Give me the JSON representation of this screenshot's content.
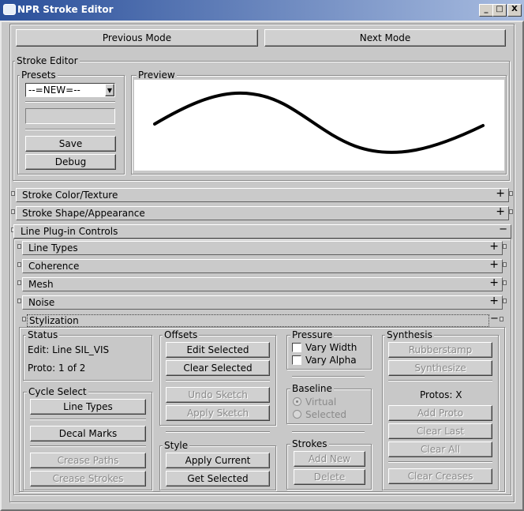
{
  "window": {
    "title": "NPR Stroke Editor",
    "minimize": "_",
    "maximize": "□",
    "close": "X"
  },
  "nav": {
    "previous": "Previous Mode",
    "next": "Next Mode"
  },
  "stroke_editor": {
    "label": "Stroke Editor",
    "presets": {
      "label": "Presets",
      "selected": "--=NEW=--",
      "name_value": "",
      "save": "Save",
      "debug": "Debug"
    },
    "preview": {
      "label": "Preview"
    }
  },
  "rollouts": {
    "color_texture": {
      "label": "Stroke Color/Texture",
      "sign": "+"
    },
    "shape_appearance": {
      "label": "Stroke Shape/Appearance",
      "sign": "+"
    },
    "line_plugin": {
      "label": "Line Plug-in Controls",
      "sign": "−"
    },
    "line_types": {
      "label": "Line Types",
      "sign": "+"
    },
    "coherence": {
      "label": "Coherence",
      "sign": "+"
    },
    "mesh": {
      "label": "Mesh",
      "sign": "+"
    },
    "noise": {
      "label": "Noise",
      "sign": "+"
    },
    "stylization": {
      "label": "Stylization",
      "sign": "−"
    }
  },
  "status": {
    "label": "Status",
    "edit": "Edit: Line SIL_VIS",
    "proto": "Proto: 1 of 2"
  },
  "cycle_select": {
    "label": "Cycle Select",
    "line_types": "Line Types",
    "decal_marks": "Decal Marks",
    "crease_paths": "Crease Paths",
    "crease_strokes": "Crease Strokes"
  },
  "offsets": {
    "label": "Offsets",
    "edit_selected": "Edit Selected",
    "clear_selected": "Clear Selected",
    "undo_sketch": "Undo Sketch",
    "apply_sketch": "Apply Sketch"
  },
  "style": {
    "label": "Style",
    "apply_current": "Apply Current",
    "get_selected": "Get Selected"
  },
  "pressure": {
    "label": "Pressure",
    "vary_width": "Vary Width",
    "vary_alpha": "Vary Alpha"
  },
  "baseline": {
    "label": "Baseline",
    "virtual": "Virtual",
    "selected": "Selected"
  },
  "strokes": {
    "label": "Strokes",
    "add_new": "Add New",
    "delete": "Delete"
  },
  "synthesis": {
    "label": "Synthesis",
    "rubberstamp": "Rubberstamp",
    "synthesize": "Synthesize",
    "protos": "Protos: X",
    "add_proto": "Add Proto",
    "clear_last": "Clear Last",
    "clear_all": "Clear All",
    "clear_creases": "Clear Creases"
  }
}
